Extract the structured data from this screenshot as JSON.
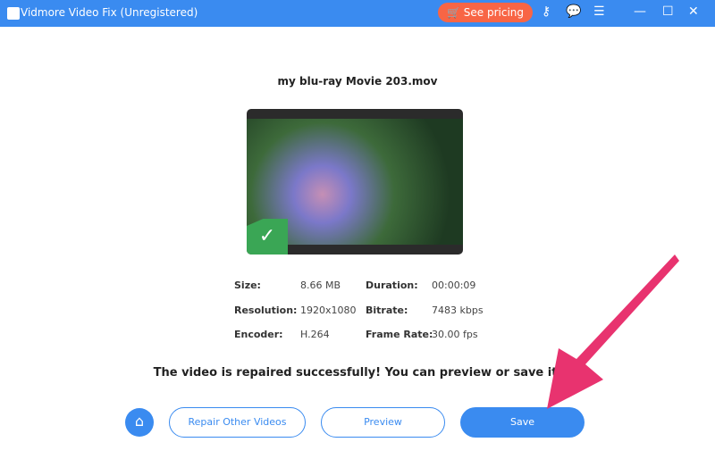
{
  "titlebar": {
    "title": "Vidmore Video Fix (Unregistered)",
    "pricing": "See pricing"
  },
  "video": {
    "filename": "my blu-ray Movie 203.mov",
    "status": "repaired"
  },
  "info": [
    {
      "label": "Size:",
      "value": "8.66 MB"
    },
    {
      "label": "Duration:",
      "value": "00:00:09"
    },
    {
      "label": "Resolution:",
      "value": "1920x1080"
    },
    {
      "label": "Bitrate:",
      "value": "7483 kbps"
    },
    {
      "label": "Encoder:",
      "value": "H.264"
    },
    {
      "label": "Frame Rate:",
      "value": "30.00 fps"
    }
  ],
  "message": "The video is repaired successfully! You can preview or save it.",
  "buttons": {
    "repair_other": "Repair Other Videos",
    "preview": "Preview",
    "save": "Save"
  },
  "colors": {
    "accent": "#3a8bf0",
    "pricing": "#f86545",
    "arrow": "#e8336f",
    "success": "#3aa655"
  }
}
